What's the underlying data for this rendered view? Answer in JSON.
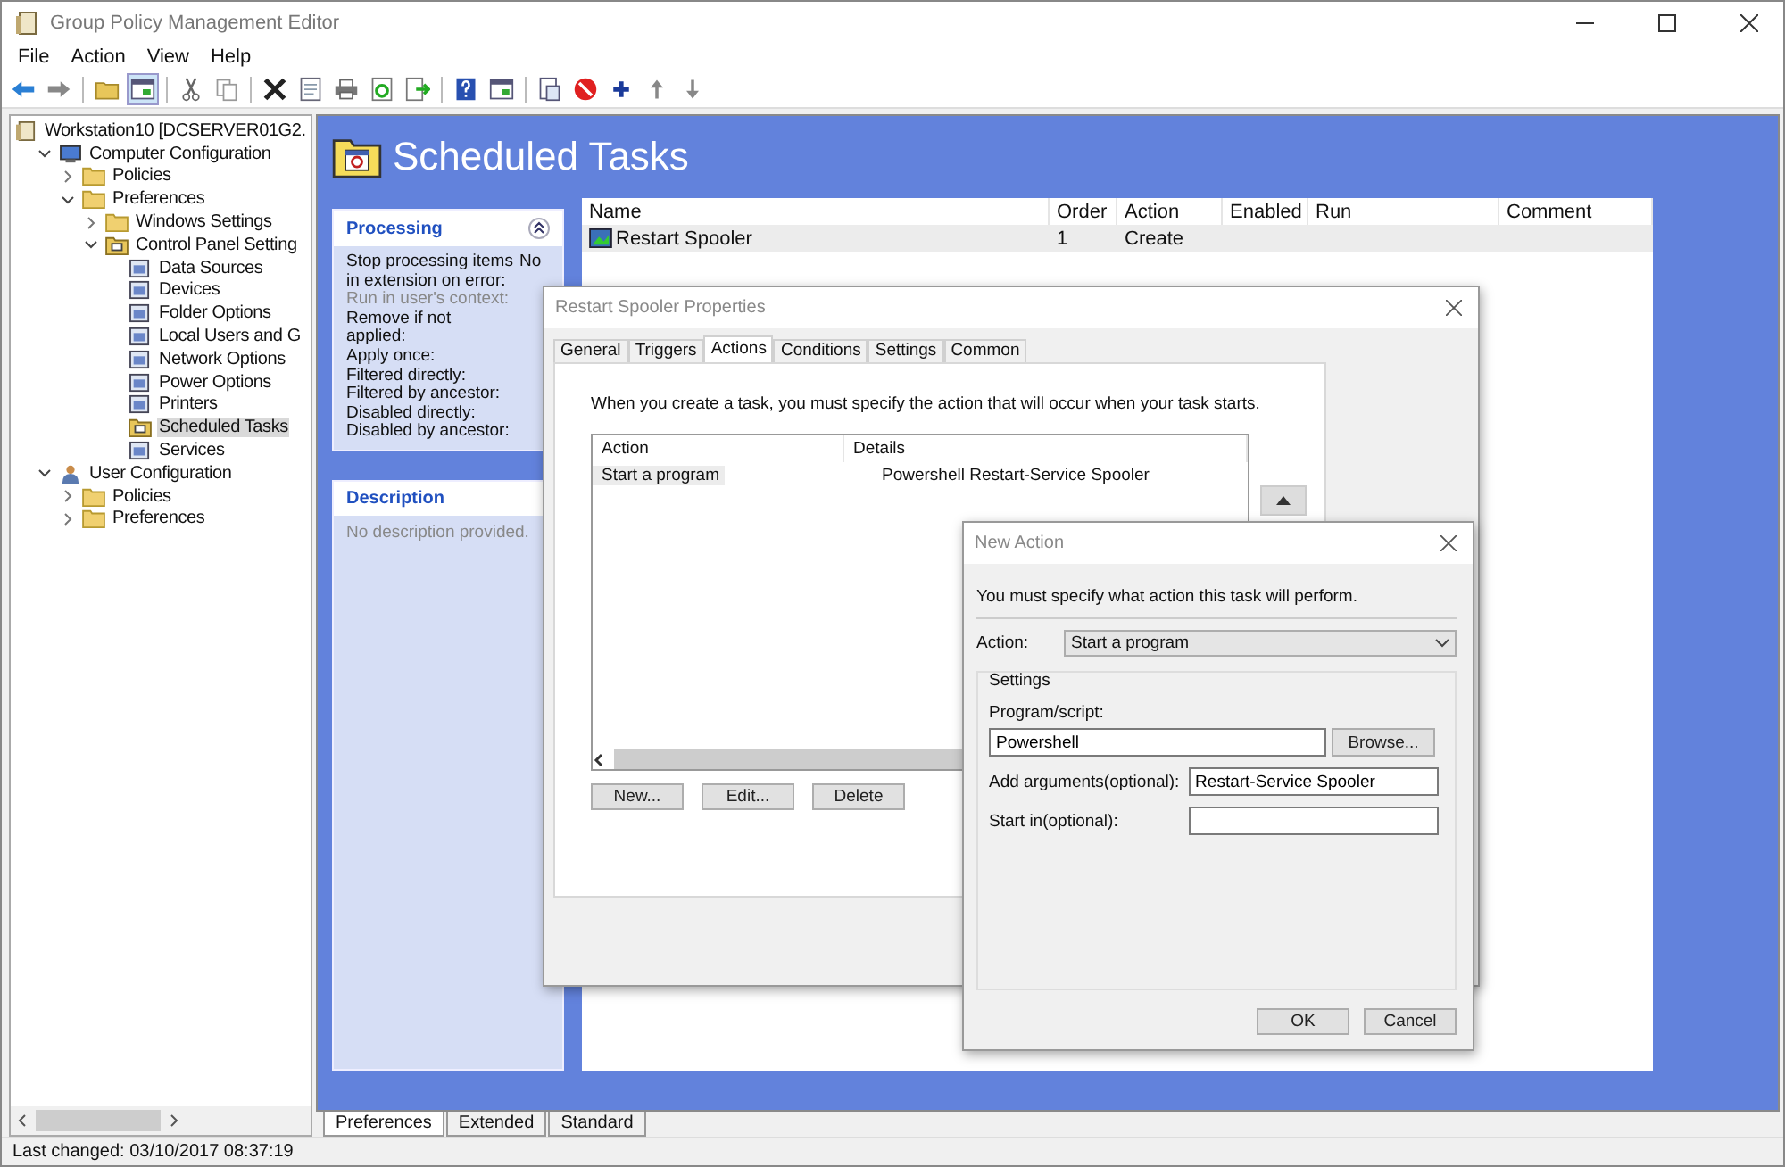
{
  "window": {
    "title": "Group Policy Management Editor"
  },
  "menu": [
    "File",
    "Action",
    "View",
    "Help"
  ],
  "tree": [
    {
      "label": "Workstation10 [DCSERVER01G2.",
      "kind": "policy",
      "selected": false,
      "children": [
        {
          "label": "Computer Configuration",
          "kind": "computer",
          "expanded": true,
          "selected": false,
          "children": [
            {
              "label": "Policies",
              "kind": "folder",
              "expanded": false,
              "selected": false
            },
            {
              "label": "Preferences",
              "kind": "folder",
              "expanded": true,
              "selected": false,
              "children": [
                {
                  "label": "Windows Settings",
                  "kind": "folder",
                  "expanded": false,
                  "selected": false
                },
                {
                  "label": "Control Panel Setting",
                  "kind": "panel",
                  "expanded": true,
                  "selected": false,
                  "children": [
                    {
                      "label": "Data Sources",
                      "kind": "item",
                      "selected": false
                    },
                    {
                      "label": "Devices",
                      "kind": "item",
                      "selected": false
                    },
                    {
                      "label": "Folder Options",
                      "kind": "item",
                      "selected": false
                    },
                    {
                      "label": "Local Users and G",
                      "kind": "item",
                      "selected": false
                    },
                    {
                      "label": "Network Options",
                      "kind": "item",
                      "selected": false
                    },
                    {
                      "label": "Power Options",
                      "kind": "item",
                      "selected": false
                    },
                    {
                      "label": "Printers",
                      "kind": "item",
                      "selected": false
                    },
                    {
                      "label": "Scheduled Tasks",
                      "kind": "panel",
                      "selected": true
                    },
                    {
                      "label": "Services",
                      "kind": "item",
                      "selected": false
                    }
                  ]
                }
              ]
            }
          ]
        },
        {
          "label": "User Configuration",
          "kind": "user",
          "expanded": true,
          "selected": false,
          "children": [
            {
              "label": "Policies",
              "kind": "folder",
              "expanded": false,
              "selected": false
            },
            {
              "label": "Preferences",
              "kind": "folder",
              "expanded": false,
              "selected": false
            }
          ]
        }
      ]
    }
  ],
  "heading": "Scheduled Tasks",
  "processing": {
    "title": "Processing",
    "rows": [
      {
        "label": "Stop processing items in extension on error:",
        "value": "No",
        "disabled": false
      },
      {
        "label": "Run in user's context:",
        "disabled": true
      },
      {
        "label": "Remove if not applied:",
        "disabled": false
      },
      {
        "label": "Apply once:",
        "disabled": false
      },
      {
        "label": "Filtered directly:",
        "disabled": false
      },
      {
        "label": "Filtered by ancestor:",
        "disabled": false
      },
      {
        "label": "Disabled directly:",
        "disabled": false
      },
      {
        "label": "Disabled by ancestor:",
        "disabled": false
      }
    ]
  },
  "description": {
    "title": "Description",
    "text": "No description provided."
  },
  "table": {
    "columns": [
      "Name",
      "Order",
      "Action",
      "Enabled",
      "Run",
      "Comment"
    ],
    "rows": [
      {
        "cells": [
          "Restart Spooler",
          "1",
          "Create",
          "",
          "",
          ""
        ],
        "selected": true
      }
    ]
  },
  "bottom_tabs": [
    {
      "label": "Preferences",
      "selected": true
    },
    {
      "label": "Extended",
      "selected": false
    },
    {
      "label": "Standard",
      "selected": false
    }
  ],
  "status_bar": "Last changed: 03/10/2017 08:37:19",
  "properties_dialog": {
    "title": "Restart Spooler Properties",
    "tabs": [
      {
        "label": "General",
        "selected": false
      },
      {
        "label": "Triggers",
        "selected": false
      },
      {
        "label": "Actions",
        "selected": true
      },
      {
        "label": "Conditions",
        "selected": false
      },
      {
        "label": "Settings",
        "selected": false
      },
      {
        "label": "Common",
        "selected": false
      }
    ],
    "intro": "When you create a task, you must specify the action that will occur when your task starts.",
    "list": {
      "columns": [
        "Action",
        "Details"
      ],
      "rows": [
        {
          "cells": [
            "Start a program",
            "Powershell Restart-Service Spooler"
          ],
          "selected": true
        }
      ]
    },
    "buttons": [
      "New...",
      "Edit...",
      "Delete"
    ]
  },
  "new_action_dialog": {
    "title": "New Action",
    "intro": "You must specify what action this task will perform.",
    "action_label": "Action:",
    "action_value": "Start a program",
    "group": "Settings",
    "program_label": "Program/script:",
    "program_value": "Powershell",
    "browse": "Browse...",
    "args_label": "Add arguments(optional):",
    "args_value": "Restart-Service Spooler",
    "startin_label": "Start in(optional):",
    "buttons": [
      "OK",
      "Cancel"
    ]
  }
}
